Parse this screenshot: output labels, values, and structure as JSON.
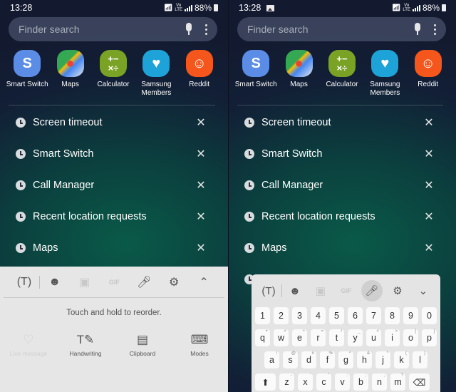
{
  "status": {
    "time": "13:28",
    "battery": "88%",
    "network": "VoLTE LTE1"
  },
  "search": {
    "placeholder": "Finder search"
  },
  "apps": [
    {
      "label": "Smart Switch",
      "icon": "smart-switch-icon",
      "color": "#5b8de6"
    },
    {
      "label": "Maps",
      "icon": "google-maps-icon",
      "color": "#4caf50"
    },
    {
      "label": "Calculator",
      "icon": "calculator-icon",
      "color": "#7aa326"
    },
    {
      "label": "Samsung Members",
      "icon": "samsung-members-icon",
      "color": "#1ea3d8"
    },
    {
      "label": "Reddit",
      "icon": "reddit-icon",
      "color": "#f4561c"
    }
  ],
  "recents": [
    "Screen timeout",
    "Smart Switch",
    "Call Manager",
    "Recent location requests",
    "Maps"
  ],
  "tools_panel": {
    "hint": "Touch and hold to reorder.",
    "tools": [
      {
        "label": "Live message",
        "enabled": false
      },
      {
        "label": "Handwriting",
        "enabled": true
      },
      {
        "label": "Clipboard",
        "enabled": true
      },
      {
        "label": "Modes",
        "enabled": true
      }
    ]
  },
  "keyboard": {
    "numbers": [
      "1",
      "2",
      "3",
      "4",
      "5",
      "6",
      "7",
      "8",
      "9",
      "0"
    ],
    "row1": [
      {
        "k": "q",
        "a": "+"
      },
      {
        "k": "w",
        "a": "×"
      },
      {
        "k": "e",
        "a": "÷"
      },
      {
        "k": "r",
        "a": "="
      },
      {
        "k": "t",
        "a": "/"
      },
      {
        "k": "y",
        "a": "_"
      },
      {
        "k": "u",
        "a": "<"
      },
      {
        "k": "i",
        "a": ">"
      },
      {
        "k": "o",
        "a": "["
      },
      {
        "k": "p",
        "a": "]"
      }
    ],
    "row2": [
      {
        "k": "a",
        "a": "!"
      },
      {
        "k": "s",
        "a": "@"
      },
      {
        "k": "d",
        "a": "#"
      },
      {
        "k": "f",
        "a": "%"
      },
      {
        "k": "g",
        "a": "^"
      },
      {
        "k": "h",
        "a": "&"
      },
      {
        "k": "j",
        "a": "*"
      },
      {
        "k": "k",
        "a": "("
      },
      {
        "k": "l",
        "a": ")"
      }
    ],
    "row3": [
      {
        "k": "z",
        "a": "-"
      },
      {
        "k": "x",
        "a": "'"
      },
      {
        "k": "c",
        "a": "\""
      },
      {
        "k": "v",
        "a": ":"
      },
      {
        "k": "b",
        "a": ";"
      },
      {
        "k": "n",
        "a": ","
      },
      {
        "k": "m",
        "a": "?"
      }
    ]
  }
}
